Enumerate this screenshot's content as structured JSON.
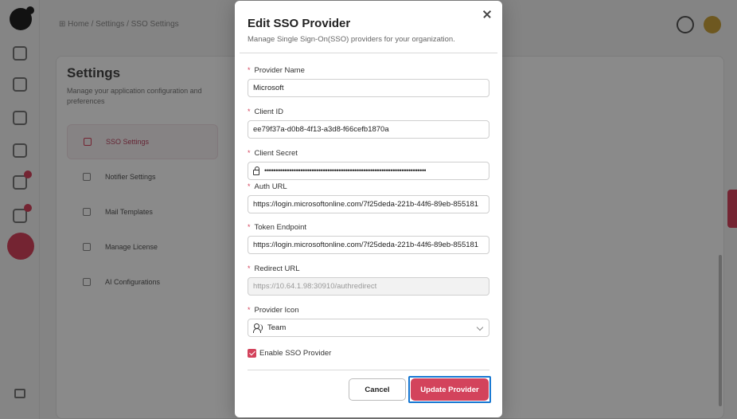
{
  "background": {
    "breadcrumb": "⊞ Home / Settings / SSO Settings",
    "page_title": "Settings",
    "page_description": "Manage your application configuration and preferences",
    "menu": [
      {
        "label": "SSO Settings",
        "active": true
      },
      {
        "label": "Notifier Settings",
        "active": false
      },
      {
        "label": "Mail Templates",
        "active": false
      },
      {
        "label": "Manage License",
        "active": false
      },
      {
        "label": "AI Configurations",
        "active": false
      }
    ]
  },
  "modal": {
    "title": "Edit SSO Provider",
    "subtitle": "Manage Single Sign-On(SSO) providers for your organization.",
    "close_label": "×",
    "required_marker": "*",
    "fields": {
      "provider_name": {
        "label": "Provider Name",
        "value": "Microsoft"
      },
      "client_id": {
        "label": "Client ID",
        "value": "ee79f37a-d0b8-4f13-a3d8-f66cefb1870a"
      },
      "client_secret": {
        "label": "Client Secret",
        "value": "••••••••••••••••••••••••••••••••••••••••••••••••••••••••••••••••••••••••"
      },
      "auth_url": {
        "label": "Auth URL",
        "value": "https://login.microsoftonline.com/7f25deda-221b-44f6-89eb-855181"
      },
      "token_endpoint": {
        "label": "Token Endpoint",
        "value": "https://login.microsoftonline.com/7f25deda-221b-44f6-89eb-855181"
      },
      "redirect_url": {
        "label": "Redirect URL",
        "value": "https://10.64.1.98:30910/authredirect"
      },
      "provider_icon": {
        "label": "Provider Icon",
        "value": "Team"
      }
    },
    "enable_sso": {
      "label": "Enable SSO Provider",
      "checked": true
    },
    "buttons": {
      "cancel": "Cancel",
      "update": "Update Provider"
    }
  },
  "colors": {
    "accent": "#d3435c",
    "focus_ring": "#1677d2"
  }
}
